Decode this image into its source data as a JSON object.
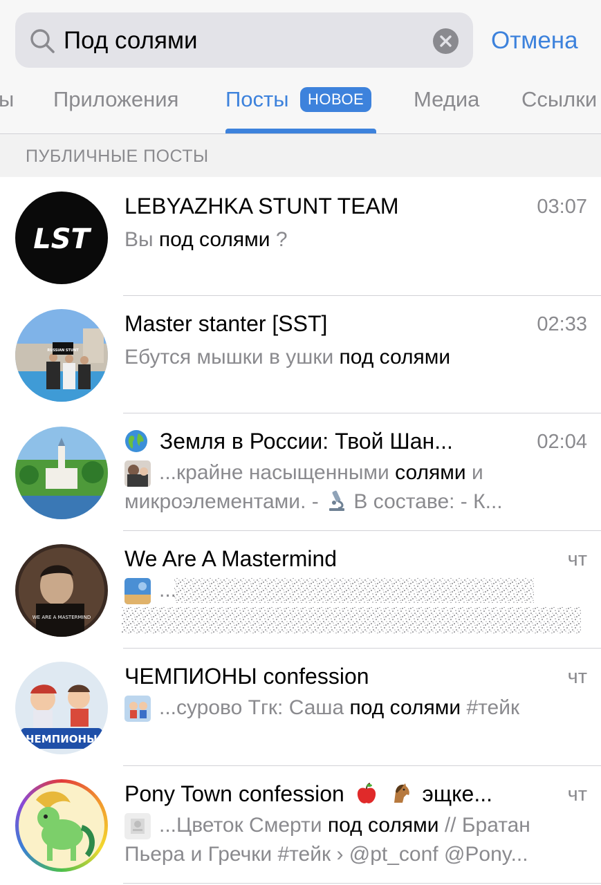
{
  "search": {
    "query": "Под солями",
    "cancel_label": "Отмена"
  },
  "tabs": [
    {
      "label": "ы",
      "active": false
    },
    {
      "label": "Приложения",
      "active": false
    },
    {
      "label": "Посты",
      "active": true,
      "badge": "НОВОЕ"
    },
    {
      "label": "Медиа",
      "active": false
    },
    {
      "label": "Ссылки",
      "active": false
    }
  ],
  "section_label": "ПУБЛИЧНЫЕ ПОСТЫ",
  "results": [
    {
      "title": "LEBYAZHKA STUNT TEAM",
      "avatar_text": "LST",
      "time": "03:07",
      "msg_pre": "Вы ",
      "msg_hl": "под солями",
      "msg_post": " ?"
    },
    {
      "title": "Master stanter [SST]",
      "avatar_text": "RUSSIAN STUNT",
      "time": "02:33",
      "msg_pre": "Ебутся мышки в ушки ",
      "msg_hl": "под солями",
      "msg_post": ""
    },
    {
      "title": "Земля в России: Твой Шан...",
      "title_emoji": "globe-emoji",
      "time": "02:04",
      "msg_pre": "...крайне насыщенными ",
      "msg_hl": "солями",
      "msg_post": " и",
      "msg_line2": "микроэлементами. - ",
      "line2_emoji": "microscope-emoji",
      "msg_line2_post": " В составе:   - К..."
    },
    {
      "title": "We Are A Mastermind",
      "avatar_text": "WE ARE A MASTERMIND",
      "time": "чт",
      "msg_pre": "...",
      "msg_hl": "",
      "msg_post": ""
    },
    {
      "title": "ЧЕМПИОНЫ confession",
      "avatar_text": "ЧЕМПИОНЫ",
      "time": "чт",
      "msg_pre": "...сурово Тгк: Саша ",
      "msg_hl": "под солями",
      "msg_post": " #тейк"
    },
    {
      "title": "Pony Town confession",
      "title_post": "эщке...",
      "title_emojis": [
        "apple-emoji",
        "horse-emoji"
      ],
      "time": "чт",
      "msg_pre": "...Цветок Смерти ",
      "msg_hl": "под солями",
      "msg_post": " // Братан",
      "msg_line2": "Пьера и Гречки #тейк › @pt_conf @Pony..."
    }
  ],
  "colors": {
    "accent": "#3d82dc",
    "secondary_text": "#8a8a8e",
    "header_bg": "#f7f7f7"
  }
}
